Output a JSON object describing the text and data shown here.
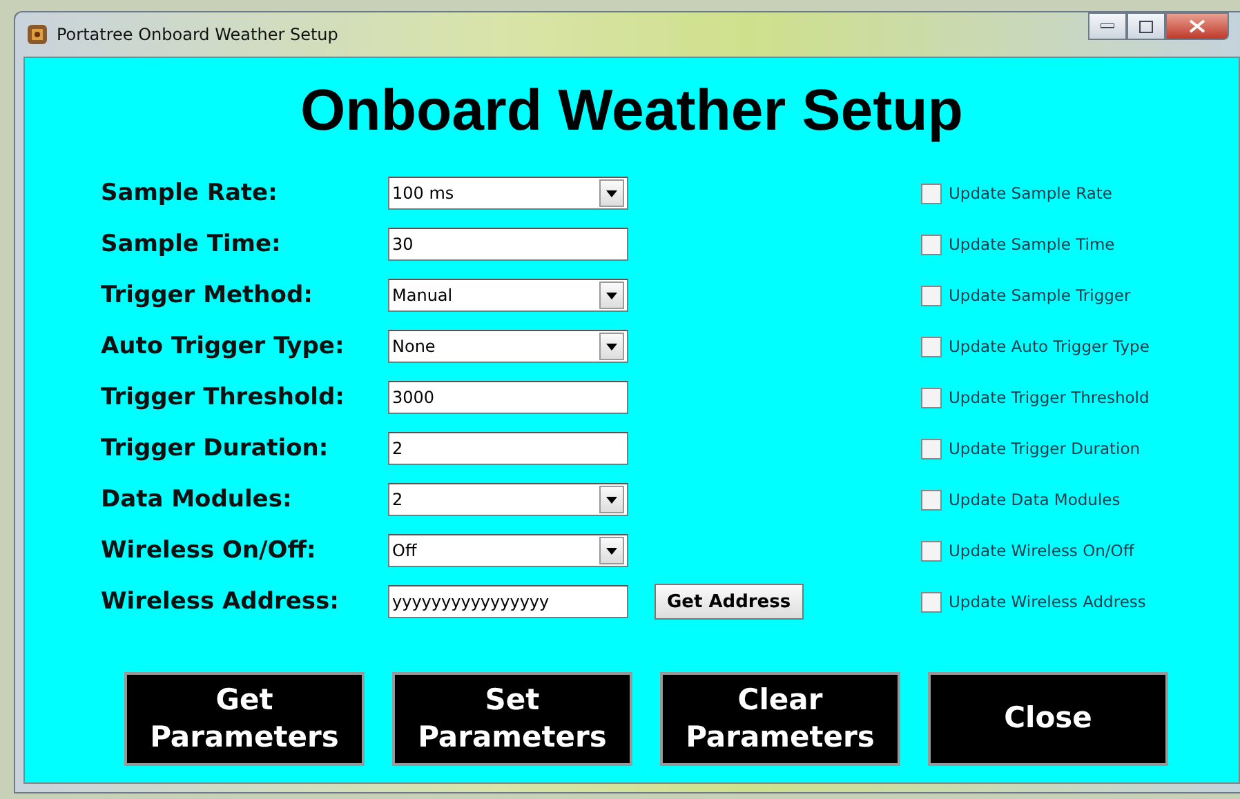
{
  "window": {
    "title": "Portatree Onboard Weather Setup"
  },
  "heading": "Onboard Weather Setup",
  "rows": [
    {
      "label": "Sample Rate:",
      "kind": "select",
      "value": "100 ms",
      "update": {
        "label": "Update Sample Rate",
        "checked": false
      }
    },
    {
      "label": "Sample Time:",
      "kind": "text",
      "value": "30",
      "update": {
        "label": "Update Sample Time",
        "checked": false
      }
    },
    {
      "label": "Trigger Method:",
      "kind": "select",
      "value": "Manual",
      "update": {
        "label": "Update Sample Trigger",
        "checked": false
      }
    },
    {
      "label": "Auto Trigger Type:",
      "kind": "select",
      "value": "None",
      "update": {
        "label": "Update Auto Trigger Type",
        "checked": false
      }
    },
    {
      "label": "Trigger Threshold:",
      "kind": "text",
      "value": "3000",
      "update": {
        "label": "Update Trigger Threshold",
        "checked": false
      }
    },
    {
      "label": "Trigger Duration:",
      "kind": "text",
      "value": "2",
      "update": {
        "label": "Update Trigger Duration",
        "checked": false
      }
    },
    {
      "label": "Data Modules:",
      "kind": "select",
      "value": "2",
      "update": {
        "label": "Update Data Modules",
        "checked": false
      }
    },
    {
      "label": "Wireless On/Off:",
      "kind": "select",
      "value": "Off",
      "update": {
        "label": "Update Wireless On/Off",
        "checked": false
      }
    },
    {
      "label": "Wireless Address:",
      "kind": "text",
      "value": "yyyyyyyyyyyyyyyy",
      "button": "Get Address",
      "update": {
        "label": "Update Wireless Address",
        "checked": false
      }
    }
  ],
  "buttons": [
    [
      "Get",
      "Parameters"
    ],
    [
      "Set",
      "Parameters"
    ],
    [
      "Clear",
      "Parameters"
    ],
    [
      "Close"
    ]
  ]
}
